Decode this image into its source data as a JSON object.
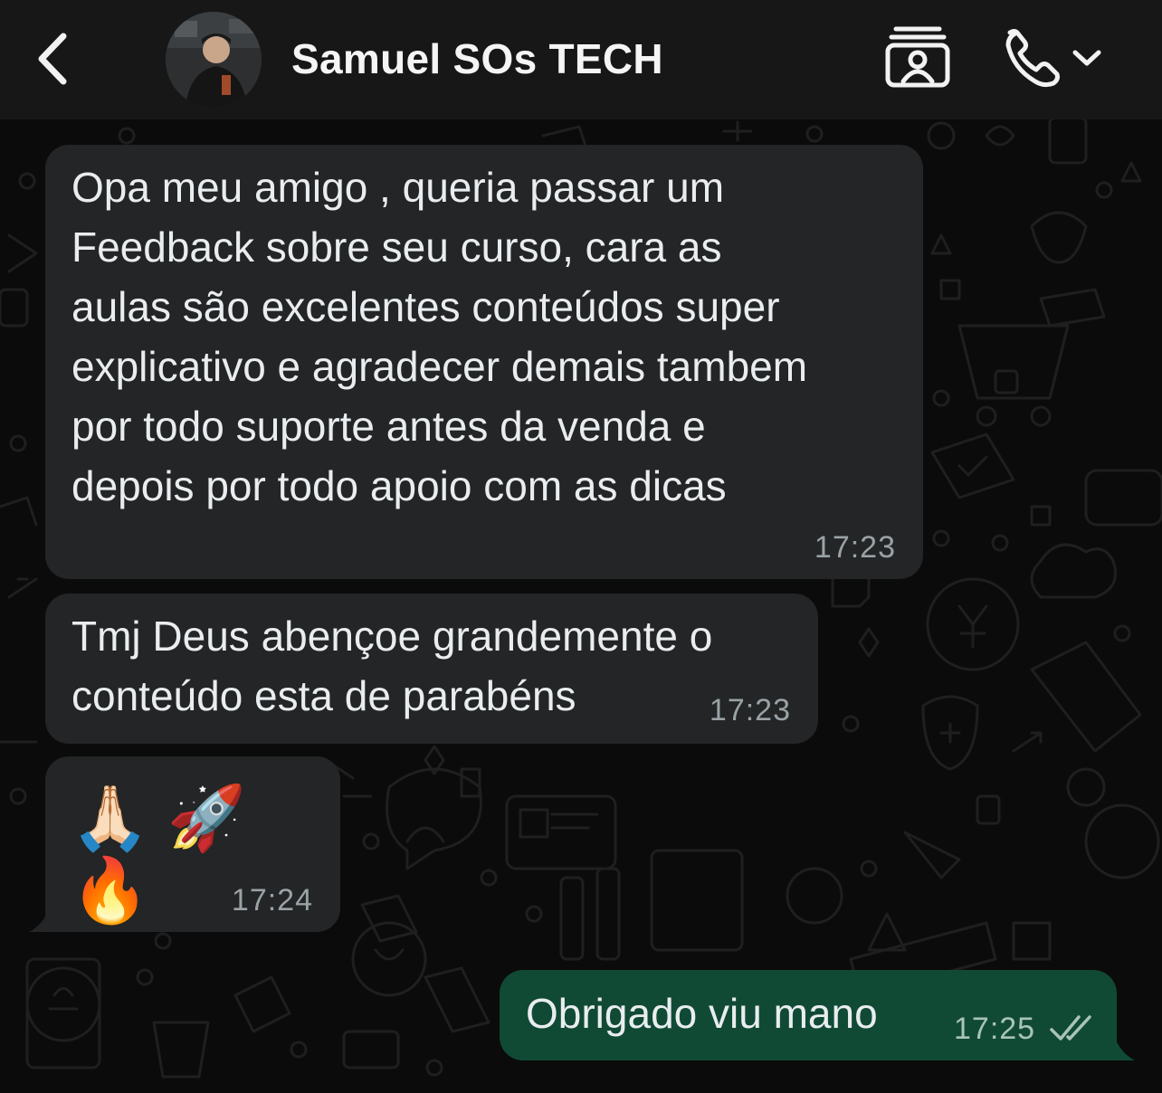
{
  "header": {
    "back_icon": "chevron-left-icon",
    "contact_name": "Samuel SOs TECH",
    "video_icon": "video-call-icon",
    "call_icon": "phone-icon",
    "call_menu_icon": "chevron-down-icon"
  },
  "messages": [
    {
      "direction": "incoming",
      "text": "Opa meu amigo , queria passar um\nFeedback sobre seu curso, cara as\naulas são excelentes conteúdos super\nexplicativo e agradecer demais tambem\npor todo suporte antes da venda e\ndepois por todo apoio com as dicas",
      "time": "17:23"
    },
    {
      "direction": "incoming",
      "text": "Tmj Deus abençoe grandemente o\nconteúdo esta de parabéns",
      "time": "17:23"
    },
    {
      "direction": "incoming",
      "text": "🙏🏻 🚀 🔥",
      "time": "17:24"
    },
    {
      "direction": "outgoing",
      "text": "Obrigado viu mano",
      "time": "17:25",
      "status": "read"
    }
  ],
  "colors": {
    "background": "#0b0b0b",
    "header": "#171717",
    "incoming_bubble": "#232526",
    "outgoing_bubble": "#104a35",
    "read_ticks": "#a9c4b8"
  }
}
